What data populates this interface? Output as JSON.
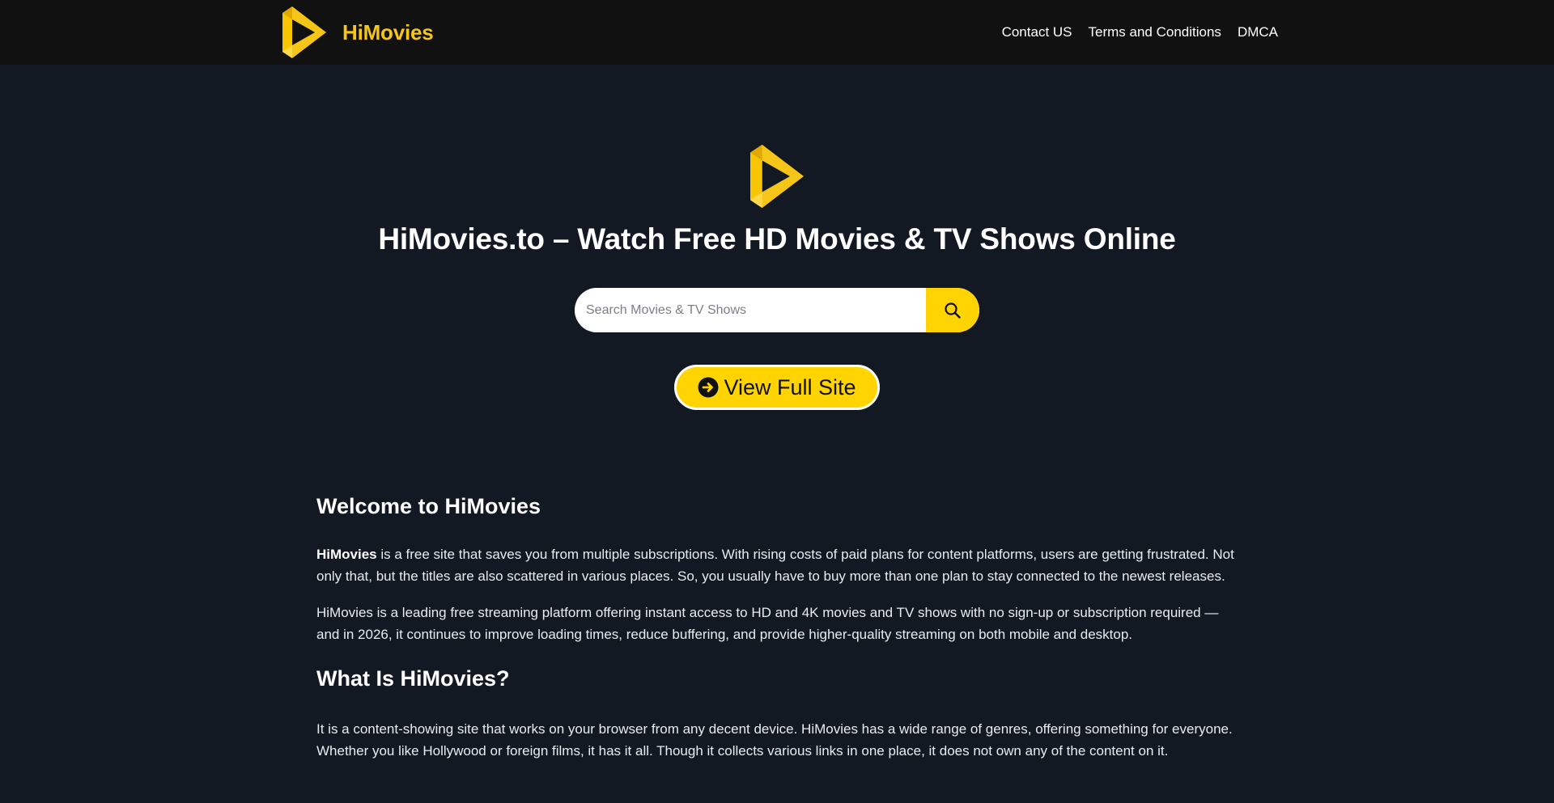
{
  "header": {
    "brand_name": "HiMovies",
    "nav": [
      {
        "label": "Contact US"
      },
      {
        "label": "Terms and Conditions"
      },
      {
        "label": "DMCA"
      }
    ]
  },
  "hero": {
    "title": "HiMovies.to – Watch Free HD Movies & TV Shows Online",
    "search_placeholder": "Search Movies & TV Shows",
    "view_full_site_label": "View Full Site"
  },
  "content": {
    "heading1": "Welcome to HiMovies",
    "p1_bold": "HiMovies",
    "p1_rest": " is a free site that saves you from multiple subscriptions. With rising costs of paid plans for content platforms, users are getting frustrated. Not only that, but the titles are also scattered in various places. So, you usually have to buy more than one plan to stay connected to the newest releases.",
    "p2": "HiMovies is a leading free streaming platform offering instant access to HD and 4K movies and TV shows with no sign-up or subscription required — and in 2026, it continues to improve loading times, reduce buffering, and provide higher-quality streaming on both mobile and desktop.",
    "heading2": "What Is HiMovies?",
    "p3": "It is a content-showing site that works on your browser from any decent device. HiMovies has a wide range of genres, offering something for everyone. Whether you like Hollywood or foreign films, it has it all. Though it collects various links in one place, it does not own any of the content on it."
  },
  "colors": {
    "accent": "#ffd400",
    "brand_text": "#f5c518",
    "header_bg": "#111111",
    "page_bg": "#131922"
  },
  "icons": {
    "logo": "play-logo-icon",
    "search": "search-icon",
    "arrow": "arrow-circle-right-icon"
  }
}
